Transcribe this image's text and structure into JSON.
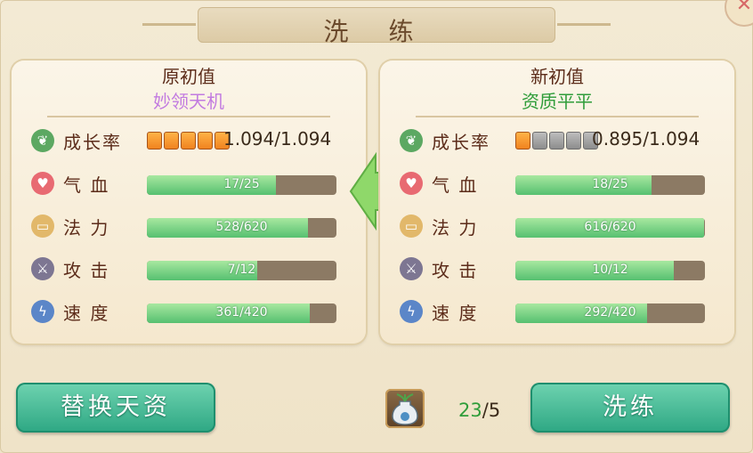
{
  "dialog": {
    "title": "洗 练",
    "close_symbol": "✕"
  },
  "left_panel": {
    "title": "原初值",
    "subtitle": "妙领天机",
    "subtitle_color": "#c27be0",
    "growth": {
      "label": "成长率",
      "value_text": "1.094/1.094",
      "stars_filled": 5,
      "stars_total": 5
    },
    "stats": [
      {
        "key": "hp",
        "label": "气 血",
        "text": "17/25",
        "current": 17,
        "max": 25,
        "icon": "heart-icon"
      },
      {
        "key": "mp",
        "label": "法 力",
        "text": "528/620",
        "current": 528,
        "max": 620,
        "icon": "scroll-icon"
      },
      {
        "key": "atk",
        "label": "攻 击",
        "text": "7/12",
        "current": 7,
        "max": 12,
        "icon": "sword-icon"
      },
      {
        "key": "spd",
        "label": "速 度",
        "text": "361/420",
        "current": 361,
        "max": 420,
        "icon": "lightning-icon"
      }
    ]
  },
  "right_panel": {
    "title": "新初值",
    "subtitle": "资质平平",
    "subtitle_color": "#2f9d3a",
    "growth": {
      "label": "成长率",
      "value_text": "0.895/1.094",
      "stars_filled": 1,
      "stars_total": 5
    },
    "stats": [
      {
        "key": "hp",
        "label": "气 血",
        "text": "18/25",
        "current": 18,
        "max": 25,
        "icon": "heart-icon"
      },
      {
        "key": "mp",
        "label": "法 力",
        "text": "616/620",
        "current": 616,
        "max": 620,
        "icon": "scroll-icon"
      },
      {
        "key": "atk",
        "label": "攻 击",
        "text": "10/12",
        "current": 10,
        "max": 12,
        "icon": "sword-icon"
      },
      {
        "key": "spd",
        "label": "速 度",
        "text": "292/420",
        "current": 292,
        "max": 420,
        "icon": "lightning-icon"
      }
    ]
  },
  "buttons": {
    "replace_label": "替换天资",
    "refine_label": "洗练"
  },
  "cost": {
    "have": "23",
    "separator": "/",
    "need": "5",
    "have_color": "#2f9d3a",
    "item_icon": "potion-vase-icon"
  },
  "colors": {
    "accent_green": "#2da783",
    "bar_fill": "#56c070",
    "bar_empty": "#8c7a64"
  }
}
